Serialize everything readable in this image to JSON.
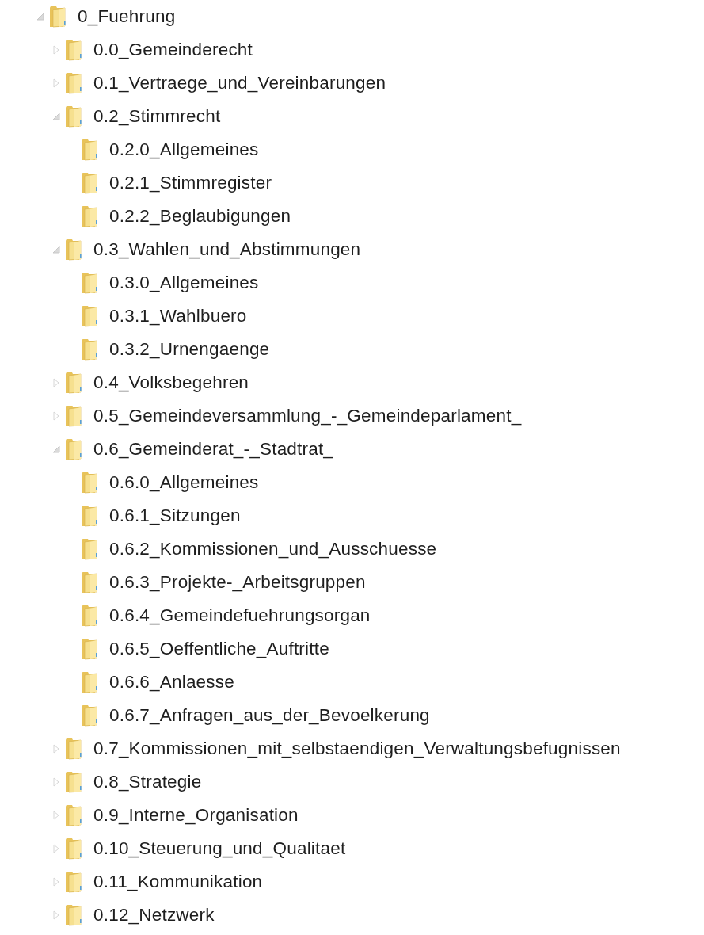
{
  "tree": [
    {
      "label": "0_Fuehrung",
      "kind": "branch",
      "expanded": true,
      "children": [
        {
          "label": "0.0_Gemeinderecht",
          "kind": "branch",
          "expanded": false
        },
        {
          "label": "0.1_Vertraege_und_Vereinbarungen",
          "kind": "branch",
          "expanded": false
        },
        {
          "label": "0.2_Stimmrecht",
          "kind": "branch",
          "expanded": true,
          "children": [
            {
              "label": "0.2.0_Allgemeines",
              "kind": "leaf"
            },
            {
              "label": "0.2.1_Stimmregister",
              "kind": "leaf"
            },
            {
              "label": "0.2.2_Beglaubigungen",
              "kind": "leaf"
            }
          ]
        },
        {
          "label": "0.3_Wahlen_und_Abstimmungen",
          "kind": "branch",
          "expanded": true,
          "children": [
            {
              "label": "0.3.0_Allgemeines",
              "kind": "leaf"
            },
            {
              "label": "0.3.1_Wahlbuero",
              "kind": "leaf"
            },
            {
              "label": "0.3.2_Urnengaenge",
              "kind": "leaf"
            }
          ]
        },
        {
          "label": "0.4_Volksbegehren",
          "kind": "branch",
          "expanded": false
        },
        {
          "label": "0.5_Gemeindeversammlung_-_Gemeindeparlament_",
          "kind": "branch",
          "expanded": false
        },
        {
          "label": "0.6_Gemeinderat_-_Stadtrat_",
          "kind": "branch",
          "expanded": true,
          "children": [
            {
              "label": "0.6.0_Allgemeines",
              "kind": "leaf"
            },
            {
              "label": "0.6.1_Sitzungen",
              "kind": "leaf"
            },
            {
              "label": "0.6.2_Kommissionen_und_Ausschuesse",
              "kind": "leaf"
            },
            {
              "label": "0.6.3_Projekte-_Arbeitsgruppen",
              "kind": "leaf"
            },
            {
              "label": "0.6.4_Gemeindefuehrungsorgan",
              "kind": "leaf"
            },
            {
              "label": "0.6.5_Oeffentliche_Auftritte",
              "kind": "leaf"
            },
            {
              "label": "0.6.6_Anlaesse",
              "kind": "leaf"
            },
            {
              "label": "0.6.7_Anfragen_aus_der_Bevoelkerung",
              "kind": "leaf"
            }
          ]
        },
        {
          "label": "0.7_Kommissionen_mit_selbstaendigen_Verwaltungsbefugnissen",
          "kind": "branch",
          "expanded": false
        },
        {
          "label": "0.8_Strategie",
          "kind": "branch",
          "expanded": false
        },
        {
          "label": "0.9_Interne_Organisation",
          "kind": "branch",
          "expanded": false
        },
        {
          "label": "0.10_Steuerung_und_Qualitaet",
          "kind": "branch",
          "expanded": false
        },
        {
          "label": "0.11_Kommunikation",
          "kind": "branch",
          "expanded": false
        },
        {
          "label": "0.12_Netzwerk",
          "kind": "branch",
          "expanded": false
        }
      ]
    }
  ]
}
